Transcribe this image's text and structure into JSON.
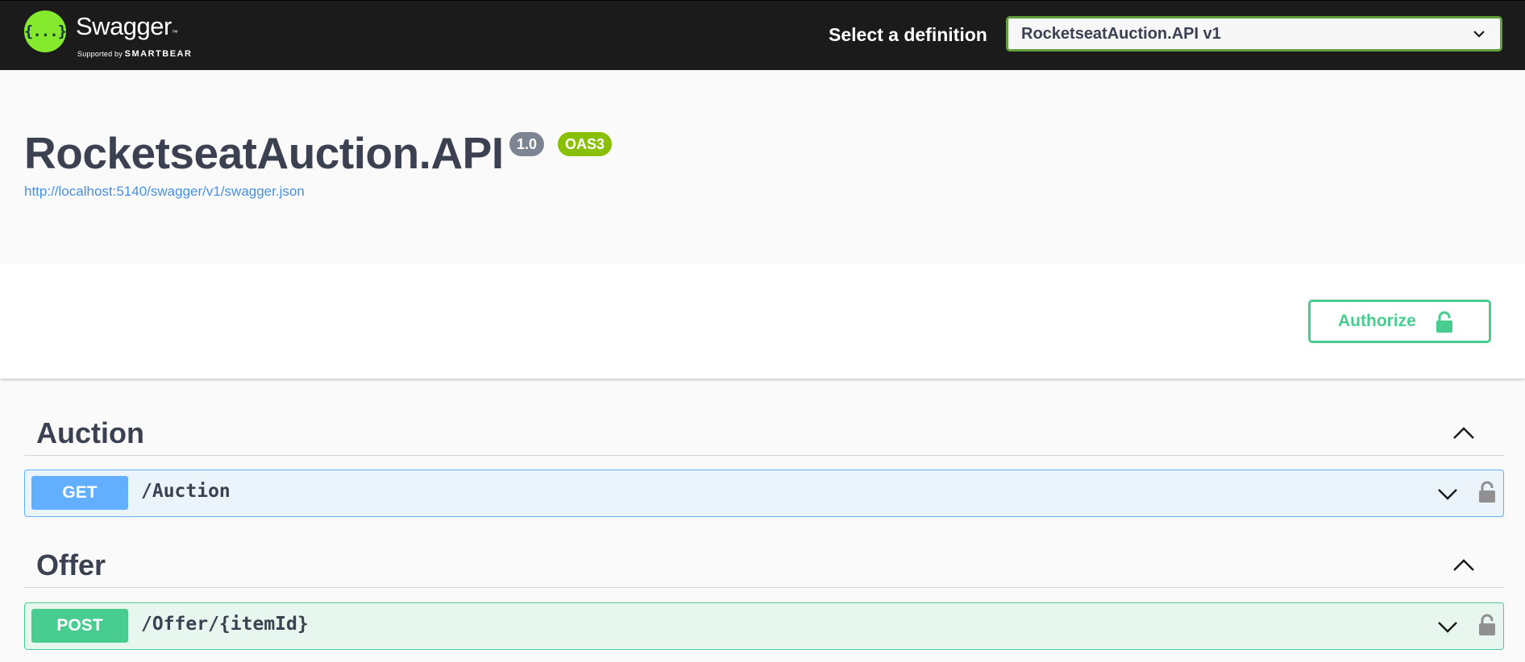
{
  "topbar": {
    "logo_glyph": "{...}",
    "brand": "Swagger",
    "brand_tm": "™",
    "supported_by": "Supported by",
    "smartbear": "SMARTBEAR",
    "select_label": "Select a definition",
    "selected_definition": "RocketseatAuction.API v1"
  },
  "info": {
    "title": "RocketseatAuction.API",
    "version": "1.0",
    "oas": "OAS3",
    "spec_url": "http://localhost:5140/swagger/v1/swagger.json"
  },
  "scheme": {
    "authorize_label": "Authorize"
  },
  "tags": [
    {
      "name": "Auction",
      "operations": [
        {
          "method": "GET",
          "path": "/Auction"
        }
      ]
    },
    {
      "name": "Offer",
      "operations": [
        {
          "method": "POST",
          "path": "/Offer/{itemId}"
        }
      ]
    }
  ],
  "colors": {
    "get": "#61affe",
    "post": "#49cc90",
    "brand_green": "#85ea2d",
    "topbar": "#1b1b1b"
  },
  "icons": [
    "chevron-down-icon",
    "chevron-up-icon",
    "lock-icon",
    "unlock-icon"
  ]
}
